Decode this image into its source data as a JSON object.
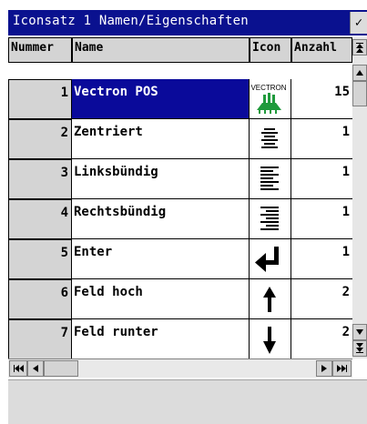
{
  "window": {
    "title": "Iconsatz 1 Namen/Eigenschaften",
    "dropdown_glyph": "✓"
  },
  "columns": {
    "nummer": "Nummer",
    "name": "Name",
    "icon": "Icon",
    "anzahl": "Anzahl"
  },
  "rows": [
    {
      "nummer": "1",
      "name": "Vectron POS",
      "icon": "vectron-logo-icon",
      "icon_text": "VECTRON",
      "anzahl": "15",
      "selected": true
    },
    {
      "nummer": "2",
      "name": "Zentriert",
      "icon": "align-center-icon",
      "anzahl": "1"
    },
    {
      "nummer": "3",
      "name": "Linksbündig",
      "icon": "align-left-icon",
      "anzahl": "1"
    },
    {
      "nummer": "4",
      "name": "Rechtsbündig",
      "icon": "align-right-icon",
      "anzahl": "1"
    },
    {
      "nummer": "5",
      "name": "Enter",
      "icon": "enter-arrow-icon",
      "anzahl": "1"
    },
    {
      "nummer": "6",
      "name": "Feld hoch",
      "icon": "arrow-up-icon",
      "anzahl": "2"
    },
    {
      "nummer": "7",
      "name": "Feld runter",
      "icon": "arrow-down-icon",
      "anzahl": "2"
    }
  ],
  "colors": {
    "title_bg": "#0a118f",
    "selection_bg": "#0a0a9a",
    "header_bg": "#d4d4d4",
    "logo_green": "#1f9a3c"
  }
}
